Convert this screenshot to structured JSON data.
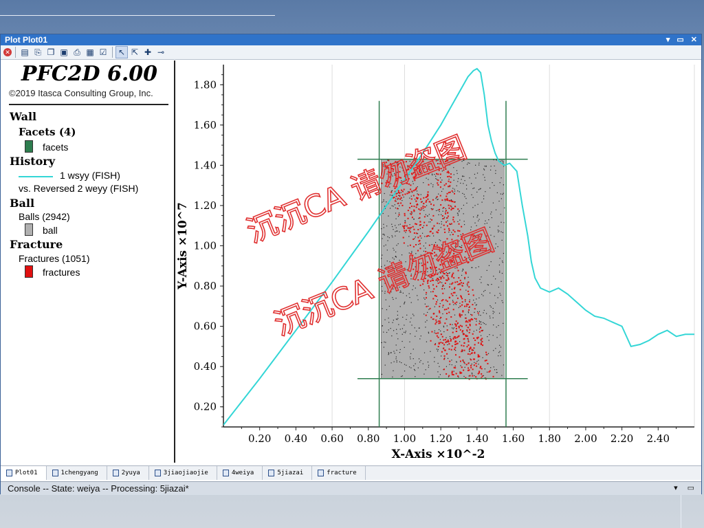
{
  "window": {
    "title": "Plot Plot01"
  },
  "legend": {
    "app_title": "PFC2D 6.00",
    "copyright": "©2019 Itasca Consulting Group, Inc.",
    "wall_heading": "Wall",
    "facets_label": "Facets (4)",
    "facets_item": "facets",
    "history_heading": "History",
    "history_item1": "1 wsyy (FISH)",
    "history_item2": "vs. Reversed 2 weyy (FISH)",
    "ball_heading": "Ball",
    "balls_label": "Balls (2942)",
    "balls_item": "ball",
    "fracture_heading": "Fracture",
    "fractures_label": "Fractures (1051)",
    "fractures_item": "fractures"
  },
  "colors": {
    "facets": "#2e7d4f",
    "history": "#33d6d6",
    "ball": "#b0b0b0",
    "fractures": "#e01010",
    "wall_lines": "#2e7d4f",
    "watermark": "#e03030"
  },
  "watermark": [
    "沉沉CA 请勿盗图",
    "沉沉CA 请勿盗图"
  ],
  "chart_data": {
    "type": "line",
    "xlabel": "X-Axis ×10^-2",
    "ylabel": "Y-Axis ×10^7",
    "xlim": [
      0,
      2.6
    ],
    "ylim": [
      0.1,
      1.9
    ],
    "xticks": [
      "0.20",
      "0.40",
      "0.60",
      "0.80",
      "1.00",
      "1.20",
      "1.40",
      "1.60",
      "1.80",
      "2.00",
      "2.20",
      "2.40"
    ],
    "yticks": [
      "0.20",
      "0.40",
      "0.60",
      "0.80",
      "1.00",
      "1.20",
      "1.40",
      "1.60",
      "1.80"
    ],
    "series": [
      {
        "x": [
          0.0,
          0.2,
          0.4,
          0.6,
          0.8,
          1.0,
          1.1,
          1.2,
          1.25,
          1.3,
          1.35,
          1.38,
          1.4,
          1.42,
          1.44,
          1.46,
          1.48,
          1.5,
          1.52,
          1.55,
          1.58,
          1.62,
          1.65,
          1.68,
          1.7,
          1.72,
          1.75,
          1.8,
          1.85,
          1.9,
          1.95,
          2.0,
          2.05,
          2.1,
          2.15,
          2.2,
          2.25,
          2.3,
          2.35,
          2.4,
          2.45,
          2.5,
          2.55,
          2.6
        ],
        "y": [
          0.11,
          0.34,
          0.58,
          0.82,
          1.07,
          1.33,
          1.46,
          1.6,
          1.68,
          1.76,
          1.84,
          1.87,
          1.88,
          1.86,
          1.75,
          1.6,
          1.52,
          1.46,
          1.42,
          1.4,
          1.41,
          1.37,
          1.2,
          1.05,
          0.92,
          0.84,
          0.79,
          0.77,
          0.79,
          0.76,
          0.72,
          0.68,
          0.65,
          0.64,
          0.62,
          0.6,
          0.5,
          0.51,
          0.53,
          0.56,
          0.58,
          0.55,
          0.56,
          0.56
        ]
      }
    ],
    "specimen": {
      "x": [
        0.87,
        1.55
      ],
      "y": [
        0.34,
        1.43
      ]
    },
    "wall_lines": {
      "vertical_x": [
        0.86,
        1.56
      ],
      "vertical_y": [
        0.1,
        1.72
      ],
      "horizontal_y": [
        0.34,
        1.43
      ],
      "horizontal_x": [
        0.74,
        1.68
      ]
    }
  },
  "tabs": [
    {
      "label": "Plot01",
      "active": true
    },
    {
      "label": "1chengyang",
      "active": false
    },
    {
      "label": "2yuya",
      "active": false
    },
    {
      "label": "3jiaojiaojie",
      "active": false
    },
    {
      "label": "4weiya",
      "active": false
    },
    {
      "label": "5jiazai",
      "active": false
    },
    {
      "label": "fracture",
      "active": false
    }
  ],
  "status": {
    "text": "Console -- State: weiya -- Processing: 5jiazai*"
  }
}
